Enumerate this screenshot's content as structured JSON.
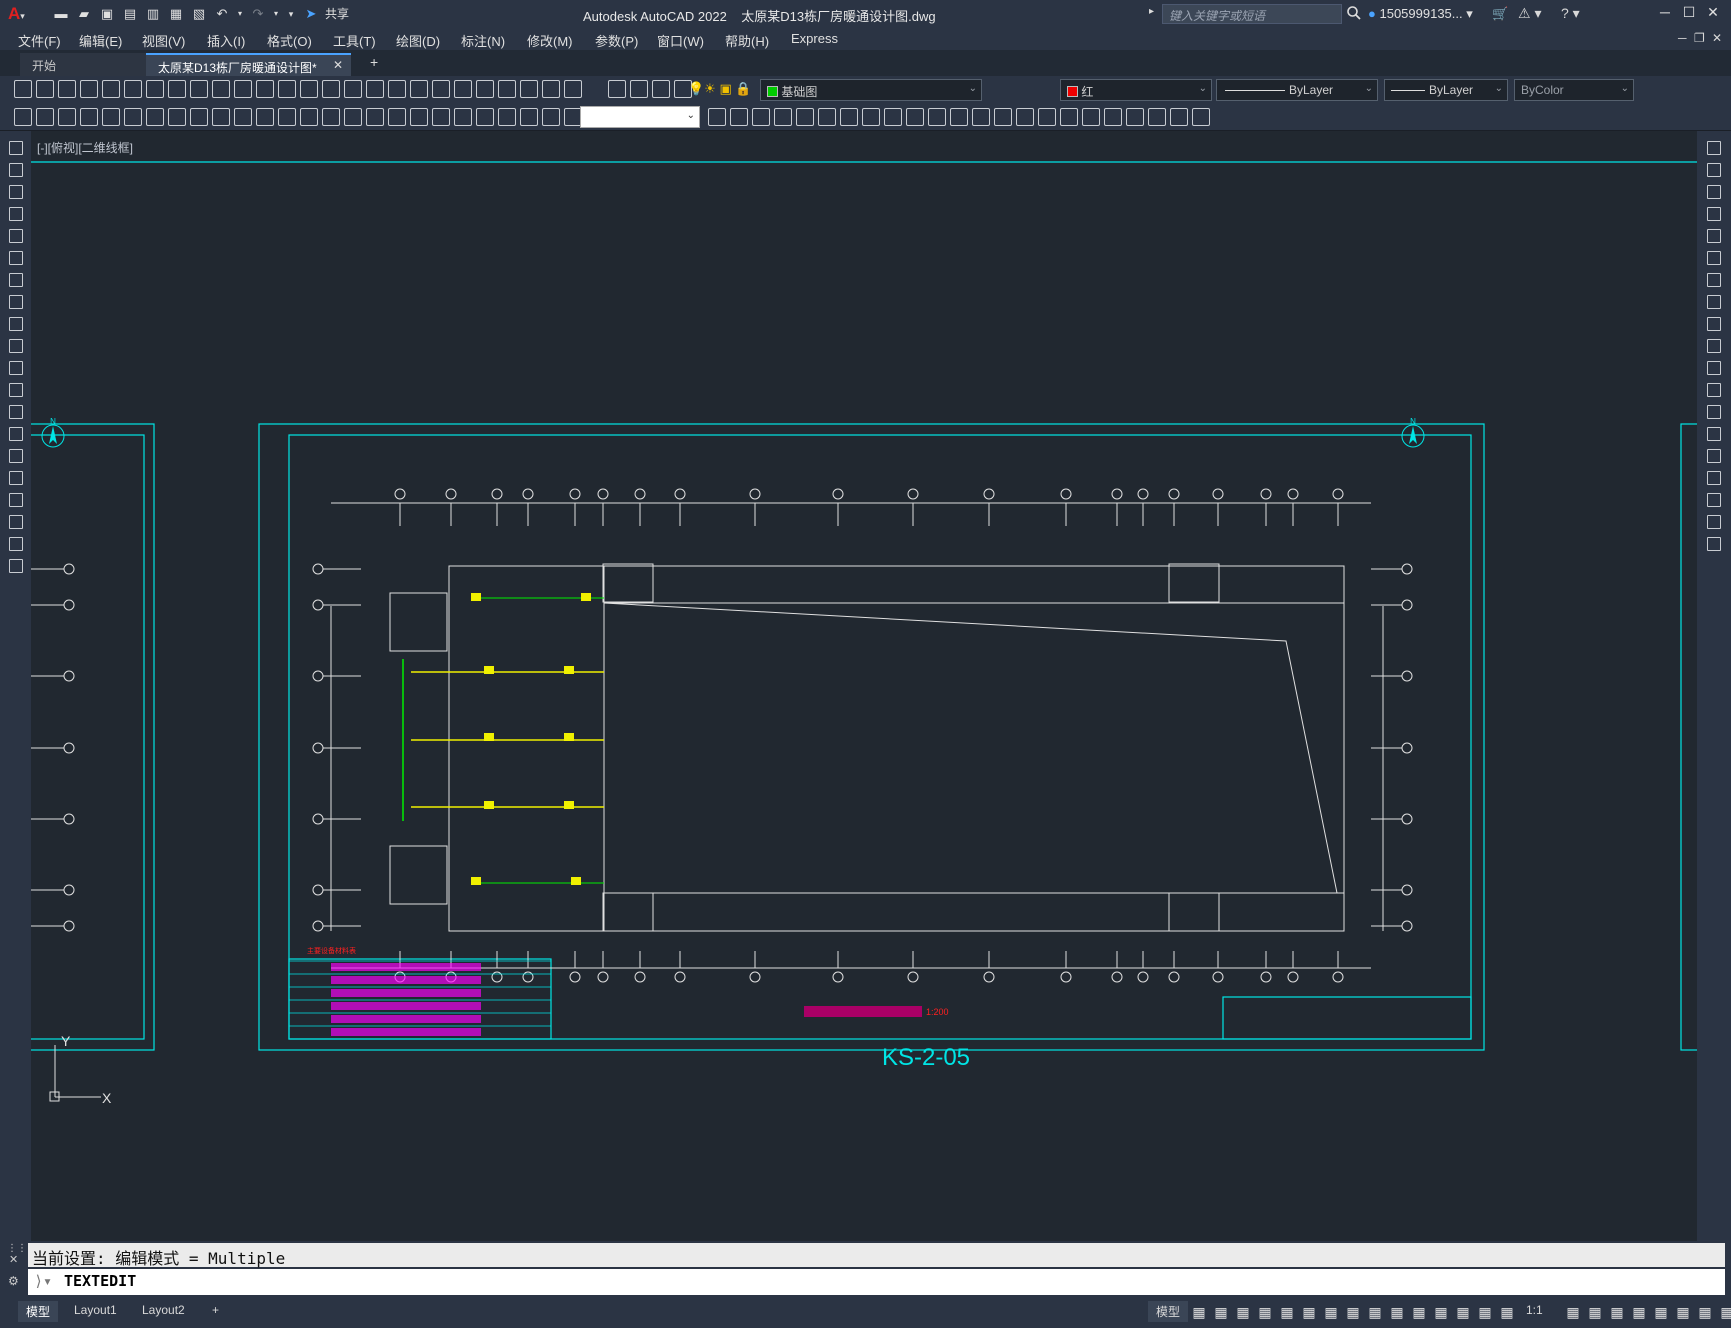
{
  "app": {
    "product": "Autodesk AutoCAD 2022",
    "document": "太原某D13栋厂房暖通设计图.dwg",
    "search_placeholder": "键入关键字或短语",
    "user": "1505999135...",
    "share_label": "共享"
  },
  "menu": [
    "文件(F)",
    "编辑(E)",
    "视图(V)",
    "插入(I)",
    "格式(O)",
    "工具(T)",
    "绘图(D)",
    "标注(N)",
    "修改(M)",
    "参数(P)",
    "窗口(W)",
    "帮助(H)",
    "Express"
  ],
  "tabs": {
    "start": "开始",
    "active": "太原某D13栋厂房暖通设计图*",
    "add": "+"
  },
  "properties": {
    "layer": "基础图",
    "color": "红",
    "linetype": "ByLayer",
    "lineweight": "ByLayer",
    "plotstyle": "ByColor",
    "layer_color": "#00cc00",
    "color_swatch": "#ee0000"
  },
  "viewport": {
    "label": "[-][俯视][二维线框]",
    "sheet_id": "KS-2-05",
    "scale": "1:200",
    "north": "N",
    "table_header": "主要设备材料表",
    "ucs_x": "X",
    "ucs_y": "Y"
  },
  "command": {
    "history": "当前设置: 编辑模式 = Multiple",
    "current": "TEXTEDIT"
  },
  "layouts": [
    "模型",
    "Layout1",
    "Layout2"
  ],
  "status": {
    "model_label": "模型",
    "scale": "1:1"
  },
  "colors": {
    "frame": "#00e5e5",
    "cad_white": "#e0e0e0",
    "cad_green": "#00ee00",
    "cad_yellow": "#f0f000",
    "cad_magenta": "#ff00ff",
    "cad_red": "#ff2020"
  }
}
